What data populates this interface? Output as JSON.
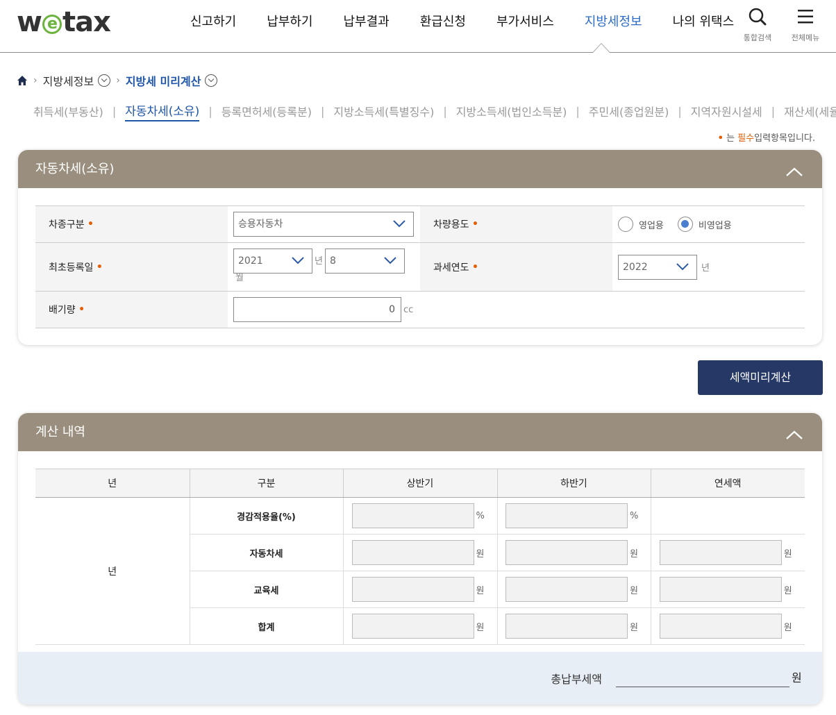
{
  "header": {
    "logo": "wetax",
    "nav": [
      "신고하기",
      "납부하기",
      "납부결과",
      "환급신청",
      "부가서비스",
      "지방세정보",
      "나의 위택스"
    ],
    "active_nav": "지방세정보",
    "search_label": "통합검색",
    "menu_label": "전체메뉴"
  },
  "breadcrumb": {
    "level1": "지방세정보",
    "level2": "지방세 미리계산"
  },
  "subtabs": [
    "취득세(부동산)",
    "자동차세(소유)",
    "등록면허세(등록분)",
    "지방소득세(특별징수)",
    "지방소득세(법인소득분)",
    "주민세(종업원분)",
    "지역자원시설세",
    "재산세(세율특례)"
  ],
  "active_subtab": "자동차세(소유)",
  "required_note": {
    "prefix": "는",
    "highlight": "필수",
    "suffix": "입력항목입니다."
  },
  "form_panel": {
    "title": "자동차세(소유)",
    "vehicle_type_label": "차종구분",
    "vehicle_type_value": "승용자동차",
    "usage_label": "차량용도",
    "usage_options": [
      "영업용",
      "비영업용"
    ],
    "usage_selected": "비영업용",
    "first_reg_label": "최초등록일",
    "first_reg_year": "2021",
    "first_reg_year_unit": "년",
    "first_reg_month": "8",
    "first_reg_month_unit": "월",
    "tax_year_label": "과세연도",
    "tax_year_value": "2022",
    "tax_year_unit": "년",
    "displacement_label": "배기량",
    "displacement_value": "0",
    "displacement_unit": "cc"
  },
  "calc_button": "세액미리계산",
  "result_panel": {
    "title": "계산 내역",
    "headers": [
      "년",
      "구분",
      "상반기",
      "하반기",
      "연세액"
    ],
    "year_cell": "년",
    "rows": [
      {
        "label": "경감적용율(%)",
        "unit": "%"
      },
      {
        "label": "자동차세",
        "unit": "원"
      },
      {
        "label": "교육세",
        "unit": "원"
      },
      {
        "label": "합계",
        "unit": "원"
      }
    ],
    "total_label": "총납부세액",
    "total_unit": "원"
  }
}
